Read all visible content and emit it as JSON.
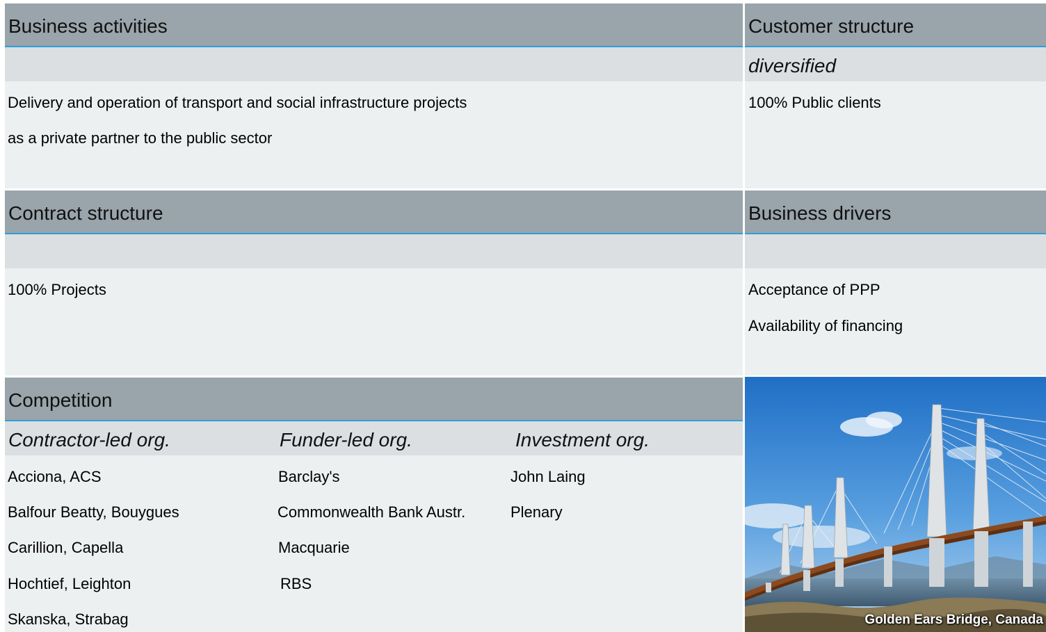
{
  "business_activities": {
    "title": "Business activities",
    "lines": [
      "Delivery and operation of transport and social infrastructure projects",
      "as a private partner to the public sector"
    ]
  },
  "customer_structure": {
    "title": "Customer structure",
    "subtitle": "diversified",
    "lines": [
      "100% Public clients"
    ]
  },
  "contract_structure": {
    "title": "Contract structure",
    "lines": [
      "100% Projects"
    ]
  },
  "business_drivers": {
    "title": "Business drivers",
    "lines": [
      "Acceptance of PPP",
      "Availability of financing"
    ]
  },
  "competition": {
    "title": "Competition",
    "columns": [
      {
        "header": "Contractor-led org.",
        "items": [
          "Acciona, ACS",
          "Balfour Beatty, Bouygues",
          "Carillion, Capella",
          "Hochtief,  Leighton",
          "Skanska, Strabag"
        ]
      },
      {
        "header": "Funder-led org.",
        "items": [
          "Barclay's",
          "Commonwealth Bank Austr.",
          "Macquarie",
          "RBS"
        ]
      },
      {
        "header": "Investment org.",
        "items": [
          "John Laing",
          "Plenary"
        ]
      }
    ]
  },
  "photo": {
    "caption": "Golden Ears Bridge, Canada"
  },
  "colors": {
    "header_bg": "#99a4ab",
    "header_rule": "#2f9fd8",
    "band_bg": "#dbdfe2",
    "body_bg": "#edf0f1"
  }
}
